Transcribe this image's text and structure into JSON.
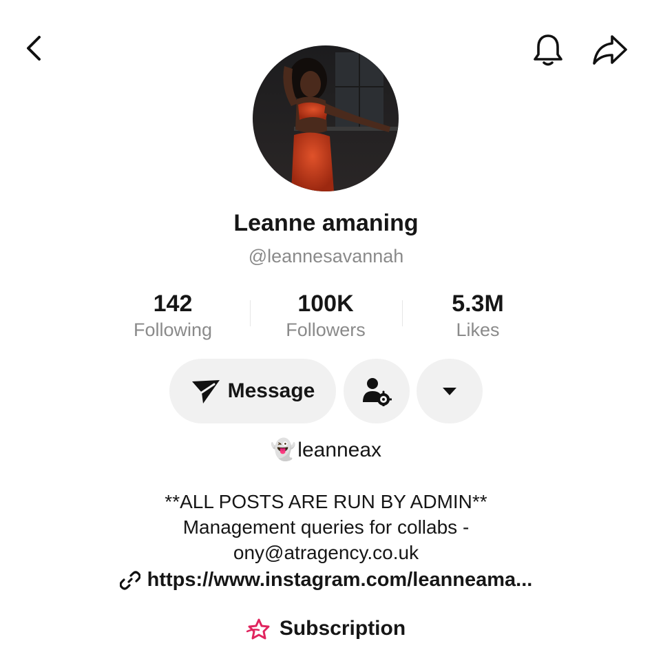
{
  "header": {
    "back_icon": "chevron-left-icon",
    "notification_icon": "bell-icon",
    "share_icon": "share-arrow-icon"
  },
  "profile": {
    "display_name": "Leanne amaning",
    "handle": "@leannesavannah"
  },
  "stats": [
    {
      "value": "142",
      "label": "Following"
    },
    {
      "value": "100K",
      "label": "Followers"
    },
    {
      "value": "5.3M",
      "label": "Likes"
    }
  ],
  "actions": {
    "message_label": "Message",
    "message_icon": "send-icon",
    "friend_settings_icon": "person-gear-icon",
    "more_icon": "caret-down-icon"
  },
  "linked_account": {
    "emoji": "👻",
    "name": "leanneax"
  },
  "bio": {
    "lines": [
      "**ALL POSTS ARE RUN BY ADMIN**",
      "Management queries for collabs -",
      "ony@atragency.co.uk"
    ]
  },
  "link": {
    "icon": "link-icon",
    "text": "https://www.instagram.com/leanneama..."
  },
  "subscription": {
    "icon": "star-badge-icon",
    "label": "Subscription",
    "icon_color": "#e0245e"
  },
  "colors": {
    "primary_text": "#161616",
    "secondary_text": "#8a8a8a",
    "button_bg": "#f1f1f1"
  }
}
